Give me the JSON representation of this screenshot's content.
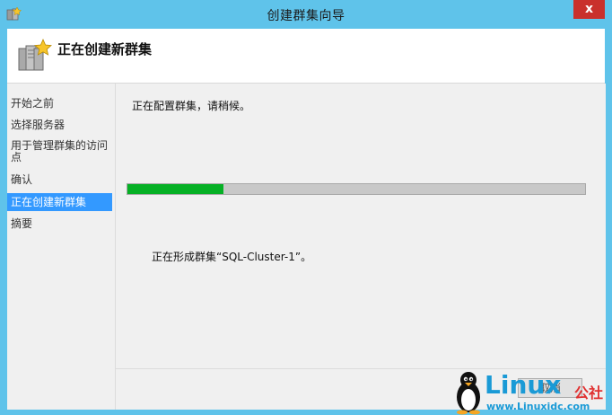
{
  "window": {
    "title": "创建群集向导",
    "close_glyph": "x"
  },
  "header": {
    "title": "正在创建新群集",
    "icon": "cluster-server-icon"
  },
  "sidebar": {
    "items": [
      {
        "label": "开始之前",
        "active": false
      },
      {
        "label": "选择服务器",
        "active": false
      },
      {
        "label": "用于管理群集的访问点",
        "active": false
      },
      {
        "label": "确认",
        "active": false
      },
      {
        "label": "正在创建新群集",
        "active": true
      },
      {
        "label": "摘要",
        "active": false
      }
    ]
  },
  "main": {
    "status_text": "正在配置群集，请稍候。",
    "progress_fraction": 0.21,
    "detail_text": "正在形成群集“SQL-Cluster-1”。",
    "button_label": "取消"
  },
  "watermark": {
    "brand": "Linux",
    "suffix": "公社",
    "url": "www.Linuxidc.com"
  },
  "colors": {
    "titlebar": "#5fc3ea",
    "close": "#c9302c",
    "active_item": "#3399ff",
    "progress_fill": "#06b025"
  }
}
